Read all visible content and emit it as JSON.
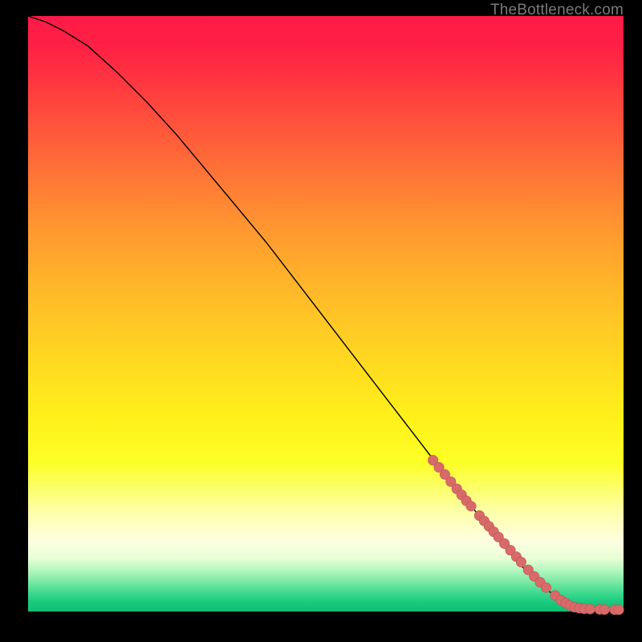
{
  "watermark": "TheBottleneck.com",
  "colors": {
    "point_fill": "#d86a6a",
    "point_stroke": "#b85454",
    "line": "#000000"
  },
  "chart_data": {
    "type": "line",
    "title": "",
    "xlabel": "",
    "ylabel": "",
    "xlim": [
      0,
      100
    ],
    "ylim": [
      0,
      100
    ],
    "series": [
      {
        "name": "curve",
        "x": [
          0,
          3,
          6,
          10,
          15,
          20,
          25,
          30,
          35,
          40,
          45,
          50,
          55,
          60,
          65,
          70,
          75,
          80,
          83,
          86,
          88,
          90,
          92,
          94,
          96,
          98,
          100
        ],
        "y": [
          100,
          99,
          97.5,
          95,
          90.5,
          85.5,
          80,
          74,
          68,
          62,
          55.5,
          49,
          42.5,
          36,
          29.5,
          23,
          17,
          11,
          7.5,
          4.5,
          3,
          1.8,
          1.0,
          0.6,
          0.4,
          0.3,
          0.3
        ]
      }
    ],
    "points": {
      "name": "highlighted-points",
      "x": [
        68,
        69,
        70,
        71,
        72,
        72.8,
        73.6,
        74.4,
        75.8,
        76.6,
        77.4,
        78.2,
        79,
        80,
        81,
        82,
        82.8,
        84,
        85,
        86,
        87,
        88.5,
        89.5,
        90.3,
        91,
        91.8,
        92.6,
        93.4,
        94.4,
        96,
        96.8,
        98.5,
        99.2
      ],
      "y": [
        25.4,
        24.2,
        23.0,
        21.8,
        20.6,
        19.6,
        18.6,
        17.7,
        16.1,
        15.2,
        14.3,
        13.4,
        12.5,
        11.4,
        10.3,
        9.2,
        8.3,
        7.0,
        5.9,
        4.9,
        4.0,
        2.7,
        1.9,
        1.4,
        1.0,
        0.7,
        0.55,
        0.45,
        0.4,
        0.35,
        0.33,
        0.3,
        0.3
      ]
    }
  }
}
